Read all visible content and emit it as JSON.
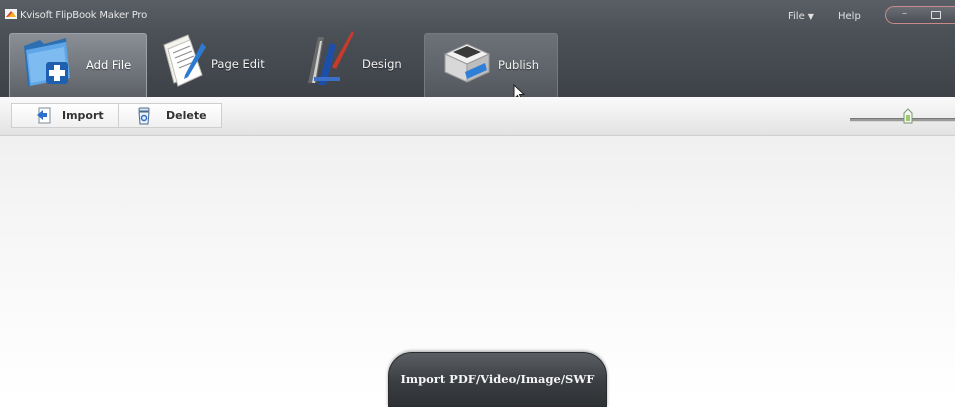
{
  "window": {
    "title": "Kvisoft FlipBook Maker Pro",
    "menu": [
      {
        "label": "File",
        "has_dropdown": true
      },
      {
        "label": "Help",
        "has_dropdown": false
      }
    ],
    "controls": [
      "minimize",
      "maximize"
    ]
  },
  "tabs": [
    {
      "label": "Add File",
      "icon": "folder-add-icon",
      "selected": true
    },
    {
      "label": "Page Edit",
      "icon": "document-pen-icon",
      "selected": false
    },
    {
      "label": "Design",
      "icon": "design-tools-icon",
      "selected": false
    },
    {
      "label": "Publish",
      "icon": "printer-icon",
      "selected": false,
      "hovered": true
    }
  ],
  "toolbar": {
    "buttons": [
      {
        "label": "Import",
        "icon": "import-icon"
      },
      {
        "label": "Delete",
        "icon": "trash-icon"
      }
    ],
    "zoom_slider": {
      "value_fraction": 0.55
    }
  },
  "main": {
    "import_button_label": "Import PDF/Video/Image/SWF"
  },
  "colors": {
    "header_dark": "#4b5057",
    "tab_selected": "#7a7f85",
    "toolbar_bg": "#ececec",
    "import_button": "#3a3d41"
  }
}
